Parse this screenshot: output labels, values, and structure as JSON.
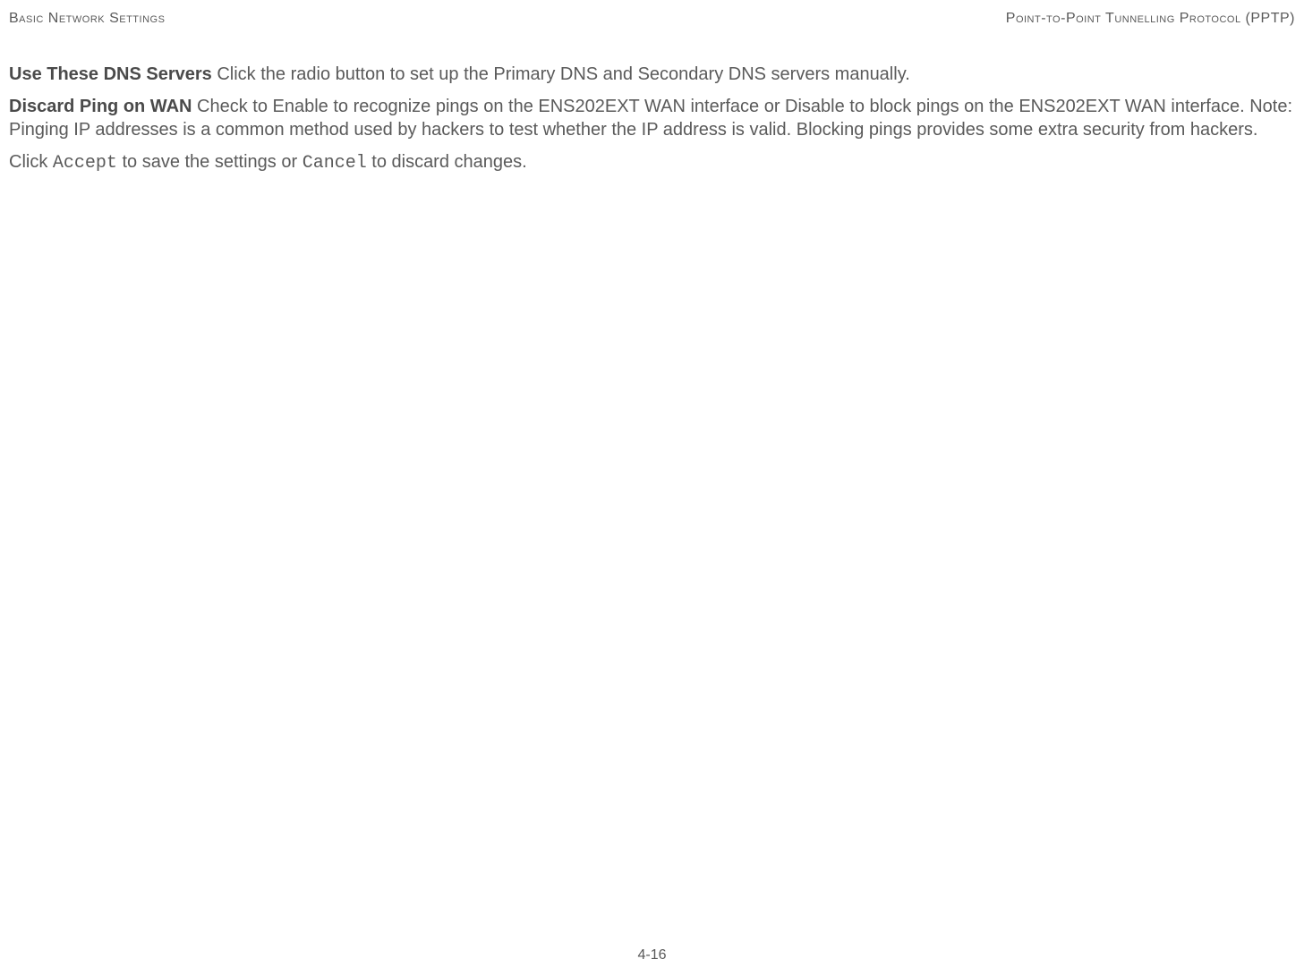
{
  "header": {
    "left": "Basic Network Settings",
    "right": "Point-to-Point Tunnelling Protocol (PPTP)"
  },
  "content": {
    "para1": {
      "label": "Use These DNS Servers",
      "text": "  Click the radio button to set up the Primary DNS and Secondary DNS servers manually."
    },
    "para2": {
      "label": "Discard Ping on WAN",
      "text": "  Check to Enable to recognize pings on the ENS202EXT WAN interface or Disable to block pings on the ENS202EXT WAN interface. Note: Pinging IP addresses is a common method used by hackers to test whether the IP address is valid. Blocking pings provides some extra security from hackers."
    },
    "para3": {
      "pre": "Click ",
      "code1": "Accept",
      "mid": " to save the settings or ",
      "code2": "Cancel",
      "post": " to discard changes."
    }
  },
  "footer": {
    "page": "4-16"
  }
}
